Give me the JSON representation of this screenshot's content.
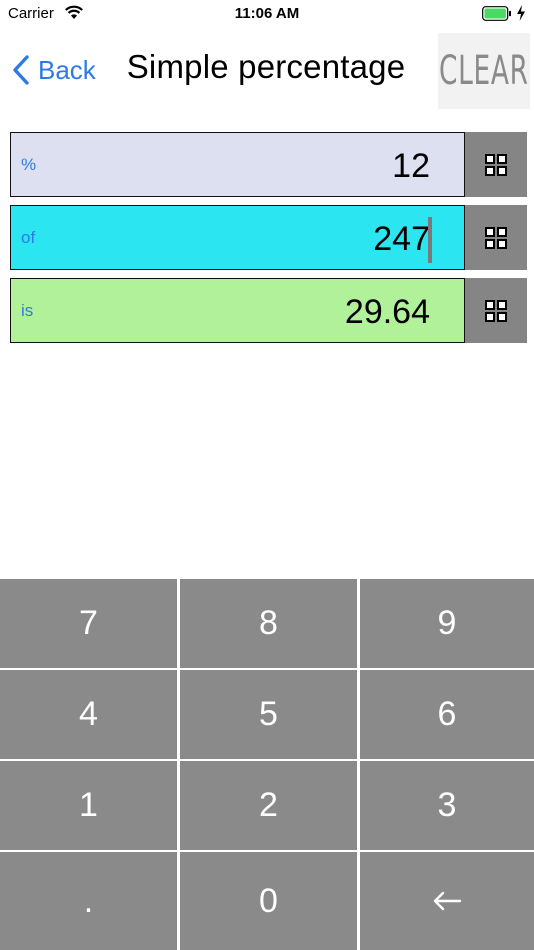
{
  "status_bar": {
    "carrier": "Carrier",
    "time": "11:06 AM",
    "battery_color": "#4cd964",
    "icons": [
      "wifi-icon",
      "battery-icon",
      "bolt-icon"
    ]
  },
  "nav": {
    "back_label": "Back",
    "title": "Simple percentage",
    "clear_label": "CLEAR",
    "accent_color": "#2c7be5"
  },
  "rows": [
    {
      "label": "%",
      "value": "12",
      "background": "#dde0f0",
      "icon": "grid-icon"
    },
    {
      "label": "of",
      "value": "247",
      "background": "#2be6f0",
      "icon": "grid-icon",
      "focused": true
    },
    {
      "label": "is",
      "value": "29.64",
      "background": "#b1f19a",
      "icon": "grid-icon"
    }
  ],
  "keypad": {
    "keys": [
      "7",
      "8",
      "9",
      "4",
      "5",
      "6",
      "1",
      "2",
      "3",
      ".",
      "0",
      "←"
    ],
    "key_color": "#8a8a8a"
  }
}
